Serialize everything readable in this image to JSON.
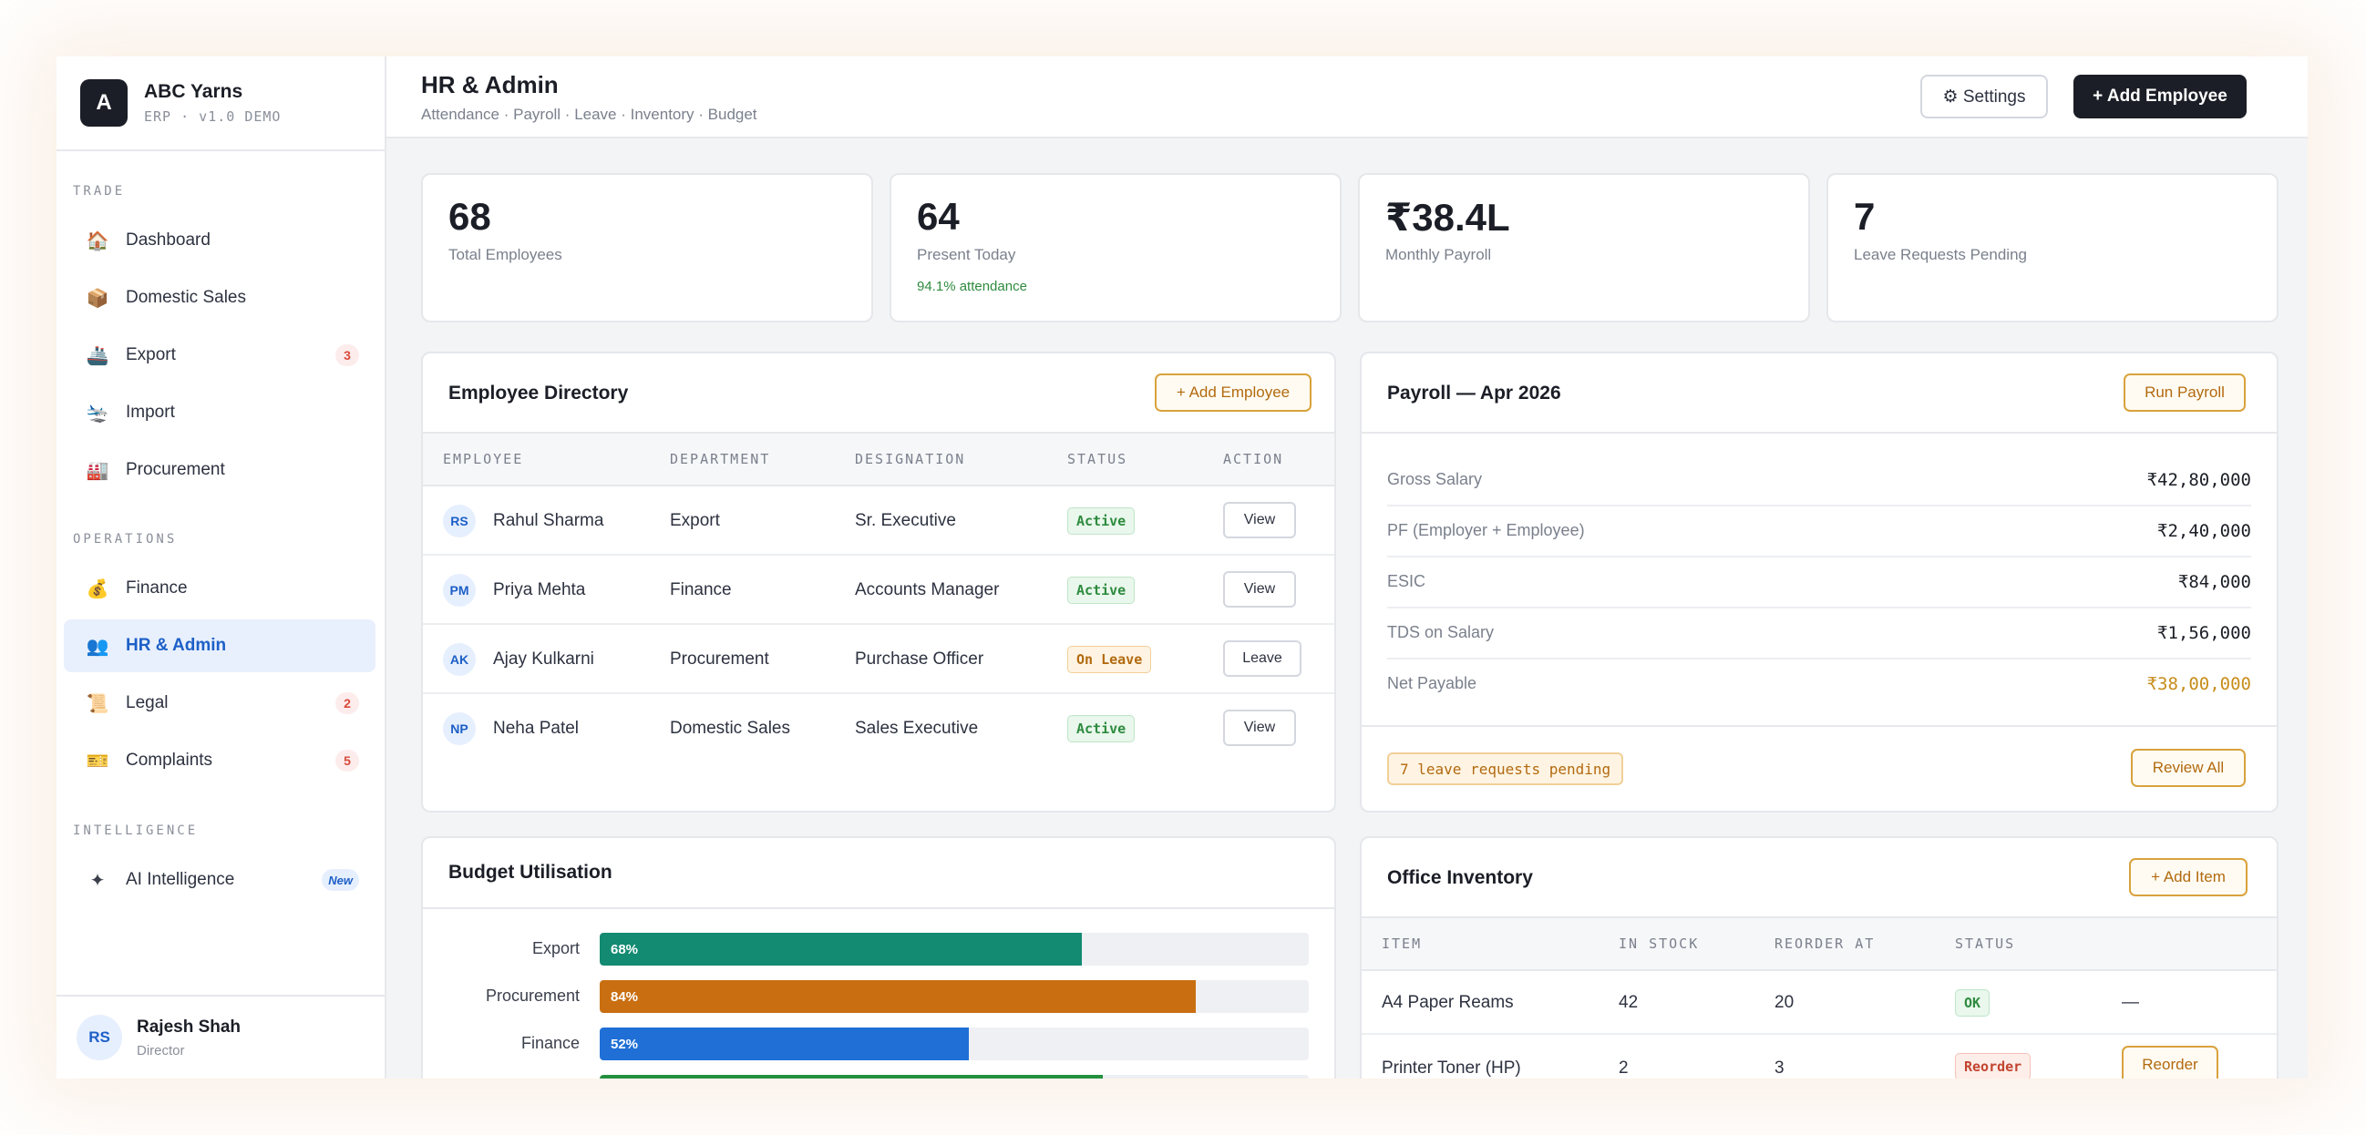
{
  "brand": {
    "logo_letter": "A",
    "name": "ABC Yarns",
    "version": "ERP · v1.0 DEMO"
  },
  "sidebar": {
    "sections": [
      {
        "label": "TRADE"
      },
      {
        "label": "OPERATIONS"
      },
      {
        "label": "INTELLIGENCE"
      }
    ],
    "items": [
      {
        "label": "Dashboard",
        "icon": "house-icon",
        "glyph": "🏠"
      },
      {
        "label": "Domestic Sales",
        "icon": "package-icon",
        "glyph": "📦"
      },
      {
        "label": "Export",
        "icon": "ship-icon",
        "glyph": "🚢",
        "badge": "3"
      },
      {
        "label": "Import",
        "icon": "plane-icon",
        "glyph": "🛬"
      },
      {
        "label": "Procurement",
        "icon": "factory-icon",
        "glyph": "🏭"
      },
      {
        "label": "Finance",
        "icon": "money-bag-icon",
        "glyph": "💰"
      },
      {
        "label": "HR & Admin",
        "icon": "people-icon",
        "glyph": "👥"
      },
      {
        "label": "Legal",
        "icon": "scroll-icon",
        "glyph": "📜",
        "badge": "2"
      },
      {
        "label": "Complaints",
        "icon": "ticket-icon",
        "glyph": "🎫",
        "badge": "5"
      },
      {
        "label": "AI Intelligence",
        "icon": "sparkle-icon",
        "glyph": "✦",
        "badge": "New"
      }
    ],
    "active_item": "HR & Admin",
    "user": {
      "initials": "RS",
      "name": "Rajesh Shah",
      "role": "Director"
    }
  },
  "header": {
    "title": "HR & Admin",
    "subtitle": "Attendance · Payroll · Leave · Inventory · Budget",
    "settings_label": "⚙ Settings",
    "add_employee_label": "+ Add Employee"
  },
  "stats": [
    {
      "value": "68",
      "label": "Total Employees"
    },
    {
      "value": "64",
      "label": "Present Today",
      "note": "94.1% attendance"
    },
    {
      "value": "₹38.4L",
      "label": "Monthly Payroll"
    },
    {
      "value": "7",
      "label": "Leave Requests Pending"
    }
  ],
  "directory": {
    "title": "Employee Directory",
    "add_label": "+ Add Employee",
    "columns": [
      "EMPLOYEE",
      "DEPARTMENT",
      "DESIGNATION",
      "STATUS",
      "ACTION"
    ],
    "rows": [
      {
        "initials": "RS",
        "name": "Rahul Sharma",
        "department": "Export",
        "designation": "Sr. Executive",
        "status": "Active",
        "action": "View"
      },
      {
        "initials": "PM",
        "name": "Priya Mehta",
        "department": "Finance",
        "designation": "Accounts Manager",
        "status": "Active",
        "action": "View"
      },
      {
        "initials": "AK",
        "name": "Ajay Kulkarni",
        "department": "Procurement",
        "designation": "Purchase Officer",
        "status": "On Leave",
        "action": "Leave"
      },
      {
        "initials": "NP",
        "name": "Neha Patel",
        "department": "Domestic Sales",
        "designation": "Sales Executive",
        "status": "Active",
        "action": "View"
      }
    ]
  },
  "payroll": {
    "title": "Payroll — Apr 2026",
    "run_label": "Run Payroll",
    "rows": [
      {
        "label": "Gross Salary",
        "value": "₹42,80,000"
      },
      {
        "label": "PF (Employer + Employee)",
        "value": "₹2,40,000"
      },
      {
        "label": "ESIC",
        "value": "₹84,000"
      },
      {
        "label": "TDS on Salary",
        "value": "₹1,56,000"
      },
      {
        "label": "Net Payable",
        "value": "₹38,00,000"
      }
    ],
    "pending_pill": "7 leave requests pending",
    "review_label": "Review All"
  },
  "budget": {
    "title": "Budget Utilisation",
    "rows": [
      {
        "label": "Export",
        "value": 68,
        "text": "68%",
        "color": "#138a72"
      },
      {
        "label": "Procurement",
        "value": 84,
        "text": "84%",
        "color": "#c96f12"
      },
      {
        "label": "Finance",
        "value": 52,
        "text": "52%",
        "color": "#1f6fd6"
      },
      {
        "label": "",
        "value": 71,
        "text": "",
        "color": "#22903c"
      }
    ]
  },
  "inventory": {
    "title": "Office Inventory",
    "add_label": "+ Add Item",
    "columns": [
      "ITEM",
      "IN STOCK",
      "REORDER AT",
      "STATUS",
      ""
    ],
    "rows": [
      {
        "item": "A4 Paper Reams",
        "stock": "42",
        "reorder_at": "20",
        "status": "OK",
        "action": "—"
      },
      {
        "item": "Printer Toner (HP)",
        "stock": "2",
        "reorder_at": "3",
        "status": "Reorder",
        "action": "Reorder"
      }
    ]
  }
}
